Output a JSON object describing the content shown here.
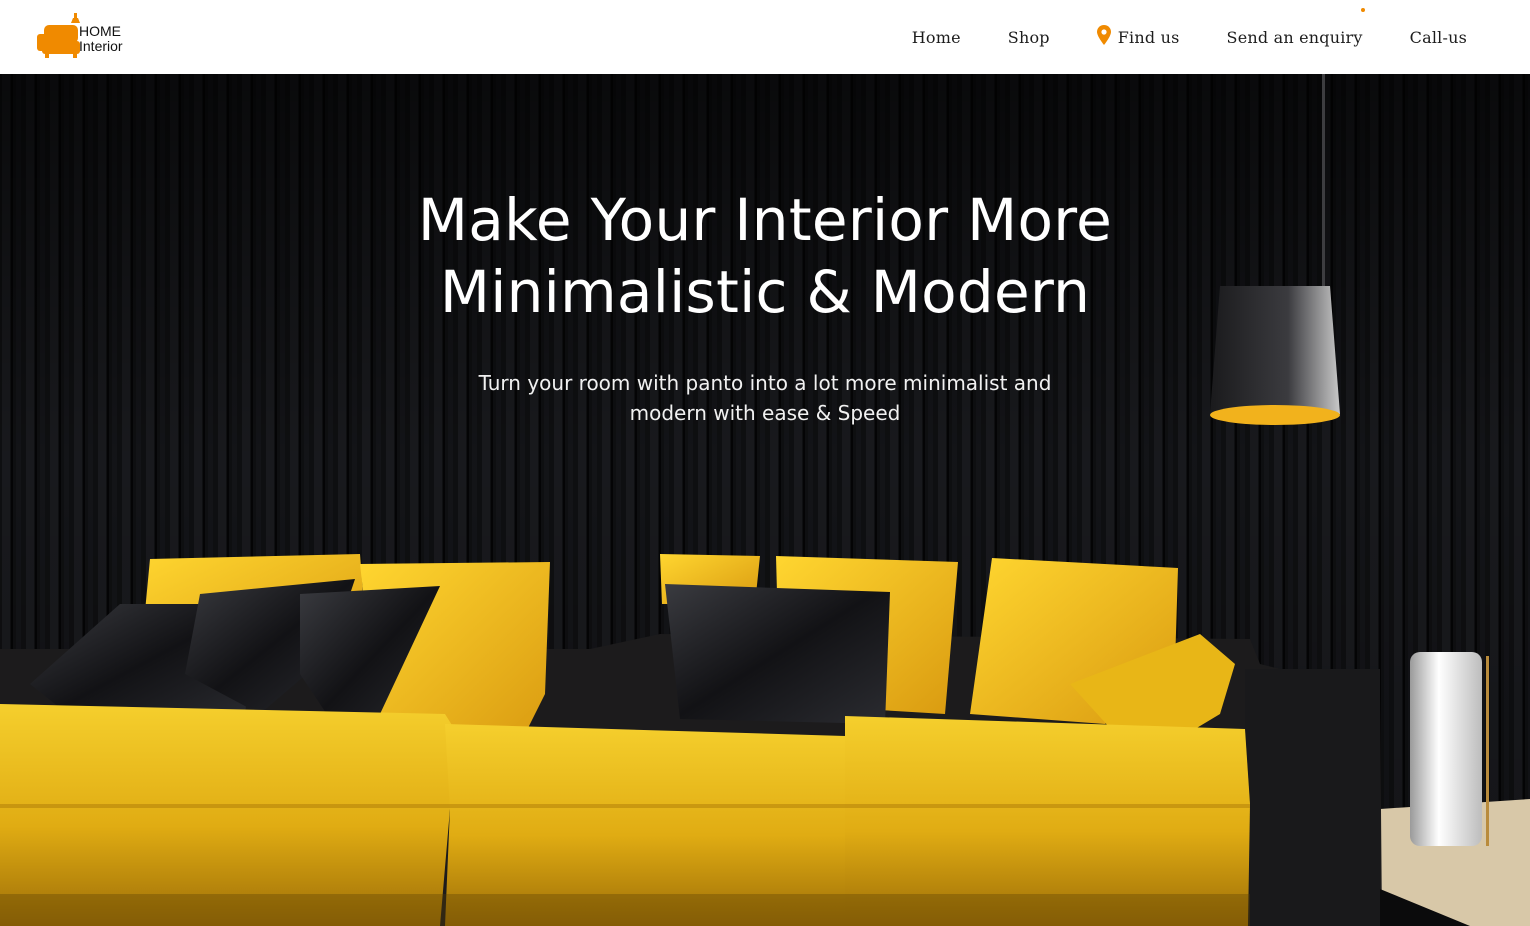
{
  "brand": {
    "line1": "HOME",
    "line2": "Interior",
    "accent": "#f08a00"
  },
  "nav": {
    "home": "Home",
    "shop": "Shop",
    "find_us": "Find us",
    "enquiry": "Send an enquiry",
    "call": "Call-us"
  },
  "hero": {
    "headline_line1": "Make Your Interior More",
    "headline_line2": "Minimalistic & Modern",
    "subtext_line1": "Turn your room with panto into a lot more minimalist and",
    "subtext_line2": "modern with ease & Speed"
  },
  "icons": {
    "logo": "sofa-lamp-icon",
    "find_us": "map-pin-icon"
  }
}
